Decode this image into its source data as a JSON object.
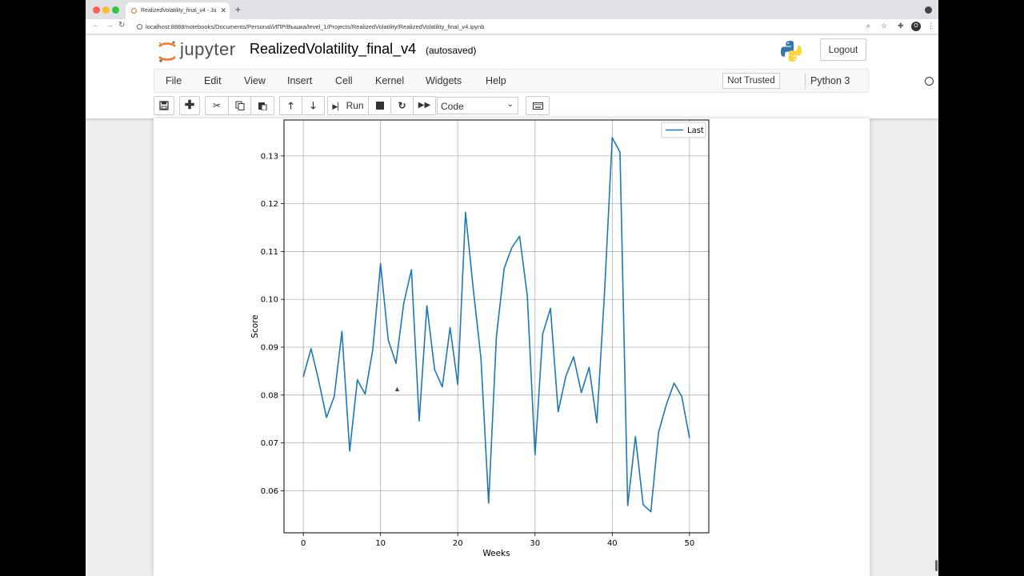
{
  "browser": {
    "tab_title": "RealizedVolatility_final_v4 - Ju",
    "tab_close": "✕",
    "new_tab": "+",
    "url": "localhost:8888/notebooks/Documents/Personal/ИПР/Вышка/level_1/Projects/RealizedVolatility/RealizedVolatility_final_v4.ipynb",
    "profile_initial": "O"
  },
  "header": {
    "logo_text": "jupyter",
    "notebook_name": "RealizedVolatility_final_v4",
    "autosave_status": "(autosaved)",
    "logout_label": "Logout"
  },
  "menu": {
    "items": [
      "File",
      "Edit",
      "View",
      "Insert",
      "Cell",
      "Kernel",
      "Widgets",
      "Help"
    ],
    "trusted_label": "Not Trusted",
    "kernel_name": "Python 3"
  },
  "toolbar": {
    "run_label": "Run",
    "cell_type": "Code",
    "icons": [
      "save-icon",
      "plus-icon",
      "cut-icon",
      "copy-icon",
      "paste-icon",
      "arrow-up-icon",
      "arrow-down-icon",
      "step-forward-icon",
      "stop-icon",
      "restart-icon",
      "fast-forward-icon",
      "keyboard-icon"
    ]
  },
  "colors": {
    "series": "#1f77b4",
    "grid": "#b0b0b0",
    "jupyter_orange": "#f37726"
  },
  "chart_data": {
    "type": "line",
    "title": "",
    "xlabel": "Weeks",
    "ylabel": "Score",
    "xlim": [
      -2.5,
      52.5
    ],
    "ylim": [
      0.0512,
      0.1375
    ],
    "xticks": [
      0,
      10,
      20,
      30,
      40,
      50
    ],
    "yticks": [
      0.06,
      0.07,
      0.08,
      0.09,
      0.1,
      0.11,
      0.12,
      0.13
    ],
    "ytick_labels": [
      "0.06",
      "0.07",
      "0.08",
      "0.09",
      "0.10",
      "0.11",
      "0.12",
      "0.13"
    ],
    "grid": true,
    "legend": "top-right",
    "series": [
      {
        "name": "Last",
        "x": [
          0,
          1,
          2,
          3,
          4,
          5,
          6,
          7,
          8,
          9,
          10,
          11,
          12,
          13,
          14,
          15,
          16,
          17,
          18,
          19,
          20,
          21,
          22,
          23,
          24,
          25,
          26,
          27,
          28,
          29,
          30,
          31,
          32,
          33,
          34,
          35,
          36,
          37,
          38,
          39,
          40,
          41,
          42,
          43,
          44,
          45,
          46,
          47,
          48,
          49,
          50
        ],
        "values": [
          0.0838,
          0.0897,
          0.083,
          0.0753,
          0.0797,
          0.0933,
          0.0683,
          0.0832,
          0.0802,
          0.0895,
          0.1075,
          0.0915,
          0.0866,
          0.0991,
          0.1062,
          0.0746,
          0.0987,
          0.0853,
          0.0817,
          0.0941,
          0.0822,
          0.1182,
          0.1023,
          0.0877,
          0.0574,
          0.0922,
          0.1065,
          0.1108,
          0.1132,
          0.1008,
          0.0675,
          0.0928,
          0.0981,
          0.0765,
          0.084,
          0.088,
          0.0805,
          0.0858,
          0.0742,
          0.1015,
          0.1338,
          0.1308,
          0.0569,
          0.0713,
          0.0571,
          0.0556,
          0.0722,
          0.078,
          0.0825,
          0.0797,
          0.071
        ]
      }
    ]
  }
}
